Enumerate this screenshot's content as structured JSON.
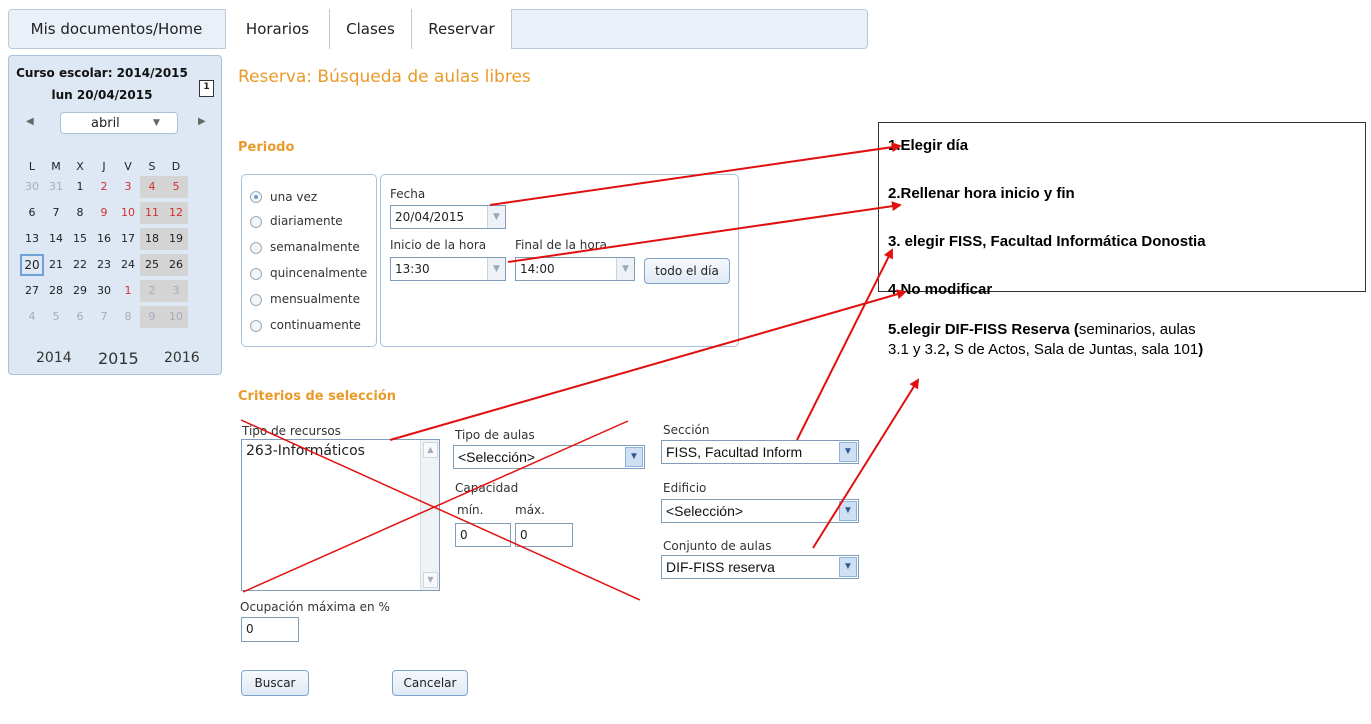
{
  "nav": {
    "tabs": [
      {
        "label": "Mis documentos/Home"
      },
      {
        "label": "Horarios"
      },
      {
        "label": "Clases"
      },
      {
        "label": "Reservar"
      }
    ]
  },
  "sidebar": {
    "school_year": "Curso escolar: 2014/2015",
    "date": "lun 20/04/2015",
    "calendar": {
      "month": "abril",
      "weekdays": [
        "L",
        "M",
        "X",
        "J",
        "V",
        "S",
        "D"
      ],
      "weeks": [
        [
          "30",
          "31",
          "1",
          "2",
          "3",
          "4",
          "5"
        ],
        [
          "6",
          "7",
          "8",
          "9",
          "10",
          "11",
          "12"
        ],
        [
          "13",
          "14",
          "15",
          "16",
          "17",
          "18",
          "19"
        ],
        [
          "20",
          "21",
          "22",
          "23",
          "24",
          "25",
          "26"
        ],
        [
          "27",
          "28",
          "29",
          "30",
          "1",
          "2",
          "3"
        ],
        [
          "4",
          "5",
          "6",
          "7",
          "8",
          "9",
          "10"
        ]
      ],
      "years": [
        "2014",
        "2015",
        "2016"
      ]
    }
  },
  "page": {
    "title": "Reserva: Búsqueda de aulas libres"
  },
  "periodo": {
    "heading": "Periodo",
    "options": [
      "una vez",
      "diariamente",
      "semanalmente",
      "quincenalmente",
      "mensualmente",
      "continuamente"
    ],
    "selected": "una vez",
    "fecha_label": "Fecha",
    "fecha_value": "20/04/2015",
    "inicio_label": "Inicio de la hora",
    "inicio_value": "13:30",
    "final_label": "Final de la hora",
    "final_value": "14:00",
    "todo_el_dia": "todo el día"
  },
  "criterios": {
    "heading": "Criterios de selección",
    "tipo_recursos_label": "Tipo de recursos",
    "tipo_recursos_item": "263-Informáticos",
    "tipo_aulas_label": "Tipo de aulas",
    "tipo_aulas_value": "<Selección>",
    "capacidad_label": "Capacidad",
    "min_label": "mín.",
    "max_label": "máx.",
    "min_value": "0",
    "max_value": "0",
    "seccion_label": "Sección",
    "seccion_value": "FISS, Facultad Inform",
    "edificio_label": "Edificio",
    "edificio_value": "<Selección>",
    "conjunto_label": "Conjunto de aulas",
    "conjunto_value": "DIF-FISS reserva",
    "ocupacion_label": "Ocupación máxima en %",
    "ocupacion_value": "0"
  },
  "actions": {
    "buscar": "Buscar",
    "cancelar": "Cancelar"
  },
  "instructions": {
    "step1": "1.Elegir día",
    "step2": "2.Rellenar hora inicio y fin",
    "step3": "3. elegir FISS, Facultad Informática Donostia",
    "step4": "4.No modificar",
    "step5_bold": "5.elegir DIF-FISS Reserva (",
    "step5_plain1": "seminarios, aulas",
    "step5_plain2": "3.1 y 3.2",
    "step5_bold2": ",",
    "step5_plain3": " S de Actos, Sala de Juntas, sala 101",
    "step5_bold3": ")"
  },
  "colors": {
    "accent": "#e99a2a",
    "arrow": "#e01010",
    "weekend_red": "#d03030"
  }
}
